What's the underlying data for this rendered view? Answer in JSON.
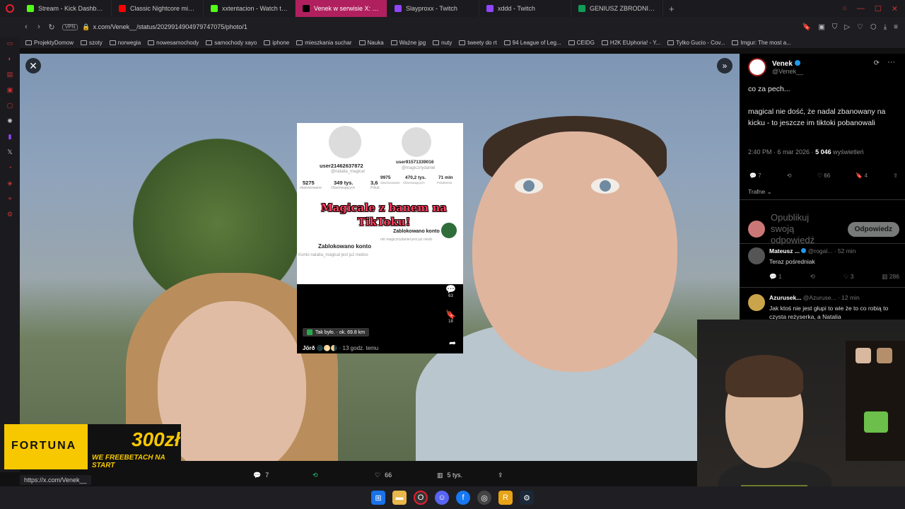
{
  "tabs": [
    {
      "label": "Stream - Kick Dashboard",
      "color": "#53fc18",
      "active": false
    },
    {
      "label": "Classic Nightcore mix - Yo",
      "color": "#ff0000",
      "active": false
    },
    {
      "label": "xxtentacion - Watch the V",
      "color": "#53fc18",
      "active": false
    },
    {
      "label": "Venek w serwisie X: „co z",
      "color": "#000000",
      "active": true
    },
    {
      "label": "Slayproxx - Twitch",
      "color": "#9146ff",
      "active": false
    },
    {
      "label": "xddd - Twitch",
      "color": "#9146ff",
      "active": false
    },
    {
      "label": "GENIUSZ ZBRODNI preLO",
      "color": "#0f9d58",
      "active": false
    }
  ],
  "address": {
    "vpn_label": "VPN",
    "url": "x.com/Venek__/status/2029914904979747075/photo/1"
  },
  "bookmarks": [
    "ProjektyDomow",
    "szoty",
    "norwegia",
    "nowesamochody",
    "samochody xayo",
    "iphone",
    "mieszkania suchar",
    "Nauka",
    "Ważne jpg",
    "nuty",
    "tweety do rt",
    "94 League of Leg...",
    "CEIDG",
    "H2K EUphoria! - Y...",
    "Tylko Gucio - Cov...",
    "Imgur: The most a..."
  ],
  "tiktok": {
    "user1": "user21462637872",
    "user1_sub": "@natalia_magical",
    "user1_stats": [
      "5275",
      "349 tys.",
      "3,6"
    ],
    "user1_stat_labels": [
      "obserwowane",
      "Obserwujących",
      "Polub"
    ],
    "user2": "user91571339016",
    "user2_sub": "@magicznydaniel",
    "user2_stats": [
      "9975",
      "470,2 tys.",
      "71 mln"
    ],
    "user2_stat_labels": [
      "obserwowane",
      "Obserwujących",
      "Polubienia"
    ],
    "headline": "Magicale z banem na TikToku!",
    "blocked1": "Zablokowano konto",
    "blocked1_sub": "Konto natalia_magical jest już niedos",
    "blocked2": "Zablokowano konto",
    "blocked2_sub": "nto magicznydaniel jest już niedo",
    "comments": "63",
    "saves": "18",
    "location": "Tak było. · ok. 69.8 km",
    "author": "Jörð",
    "time": "· 13 godz. temu"
  },
  "viewer_actions": {
    "replies": "7",
    "likes": "66",
    "views": "5 tys."
  },
  "tweet": {
    "name": "Venek",
    "handle": "@Venek__",
    "line1": "co za pech...",
    "line2": "magical nie dość, że nadal zbanowany na kicku - to jeszcze im tiktoki pobanowali",
    "time": "2:40 PM · 6 mar 2026 ·",
    "views_count": "5 046",
    "views_label": "wyświetleń",
    "replies": "7",
    "likes": "66",
    "bookmarks": "4",
    "sort": "Trafne",
    "reply_placeholder": "Opublikuj swoją odpowiedź",
    "reply_button": "Odpowiedz",
    "comments": [
      {
        "name": "Mateusz ...",
        "handle": "@rogal... · 52 min",
        "text": "Teraz pośredniak",
        "replies": "1",
        "likes": "3",
        "views": "286"
      },
      {
        "name": "Azurusek...",
        "handle": "@Azuruse... · 12 min",
        "text": "Jak ktoś nie jest głupi to wie że to co robią to czysta reżyserka, a Natalia",
        "replies": "",
        "likes": "",
        "views": ""
      }
    ]
  },
  "fortuna": {
    "logo": "FORTUNA",
    "amount": "300zł",
    "sub": "WE FREEBETACH NA START"
  },
  "status_link": "https://x.com/Venek__"
}
